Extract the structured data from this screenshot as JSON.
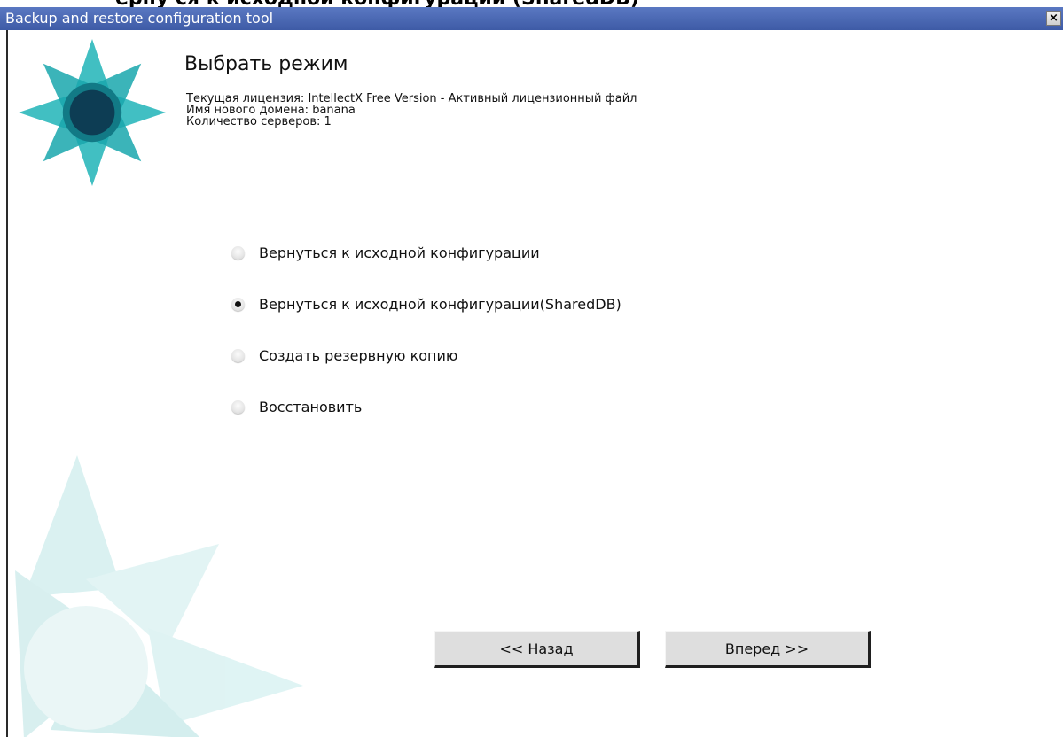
{
  "top_fragment": "ерну ся к исходной конфигурации (SharedDB)",
  "window": {
    "title": "Backup and restore configuration tool",
    "close_label": "×"
  },
  "header": {
    "title": "Выбрать режим",
    "license_line": "Текущая лицензия: IntellectX Free Version - Активный лицензионный файл",
    "domain_line": "Имя нового домена: banana",
    "servers_line": "Количество серверов: 1"
  },
  "options": [
    {
      "label": "Вернуться к исходной конфигурации",
      "checked": false
    },
    {
      "label": "Вернуться к исходной конфигурации(SharedDB)",
      "checked": true
    },
    {
      "label": "Создать резервную копию",
      "checked": false
    },
    {
      "label": "Восстановить",
      "checked": false
    }
  ],
  "buttons": {
    "back": "<< Назад",
    "next": "Вперед >>"
  },
  "colors": {
    "titlebar": "#4a68b4",
    "logo_teal": "#20b4b8",
    "logo_dark": "#0d3d54"
  },
  "icons": {
    "logo": "flower-logo-icon",
    "close": "close-icon"
  }
}
